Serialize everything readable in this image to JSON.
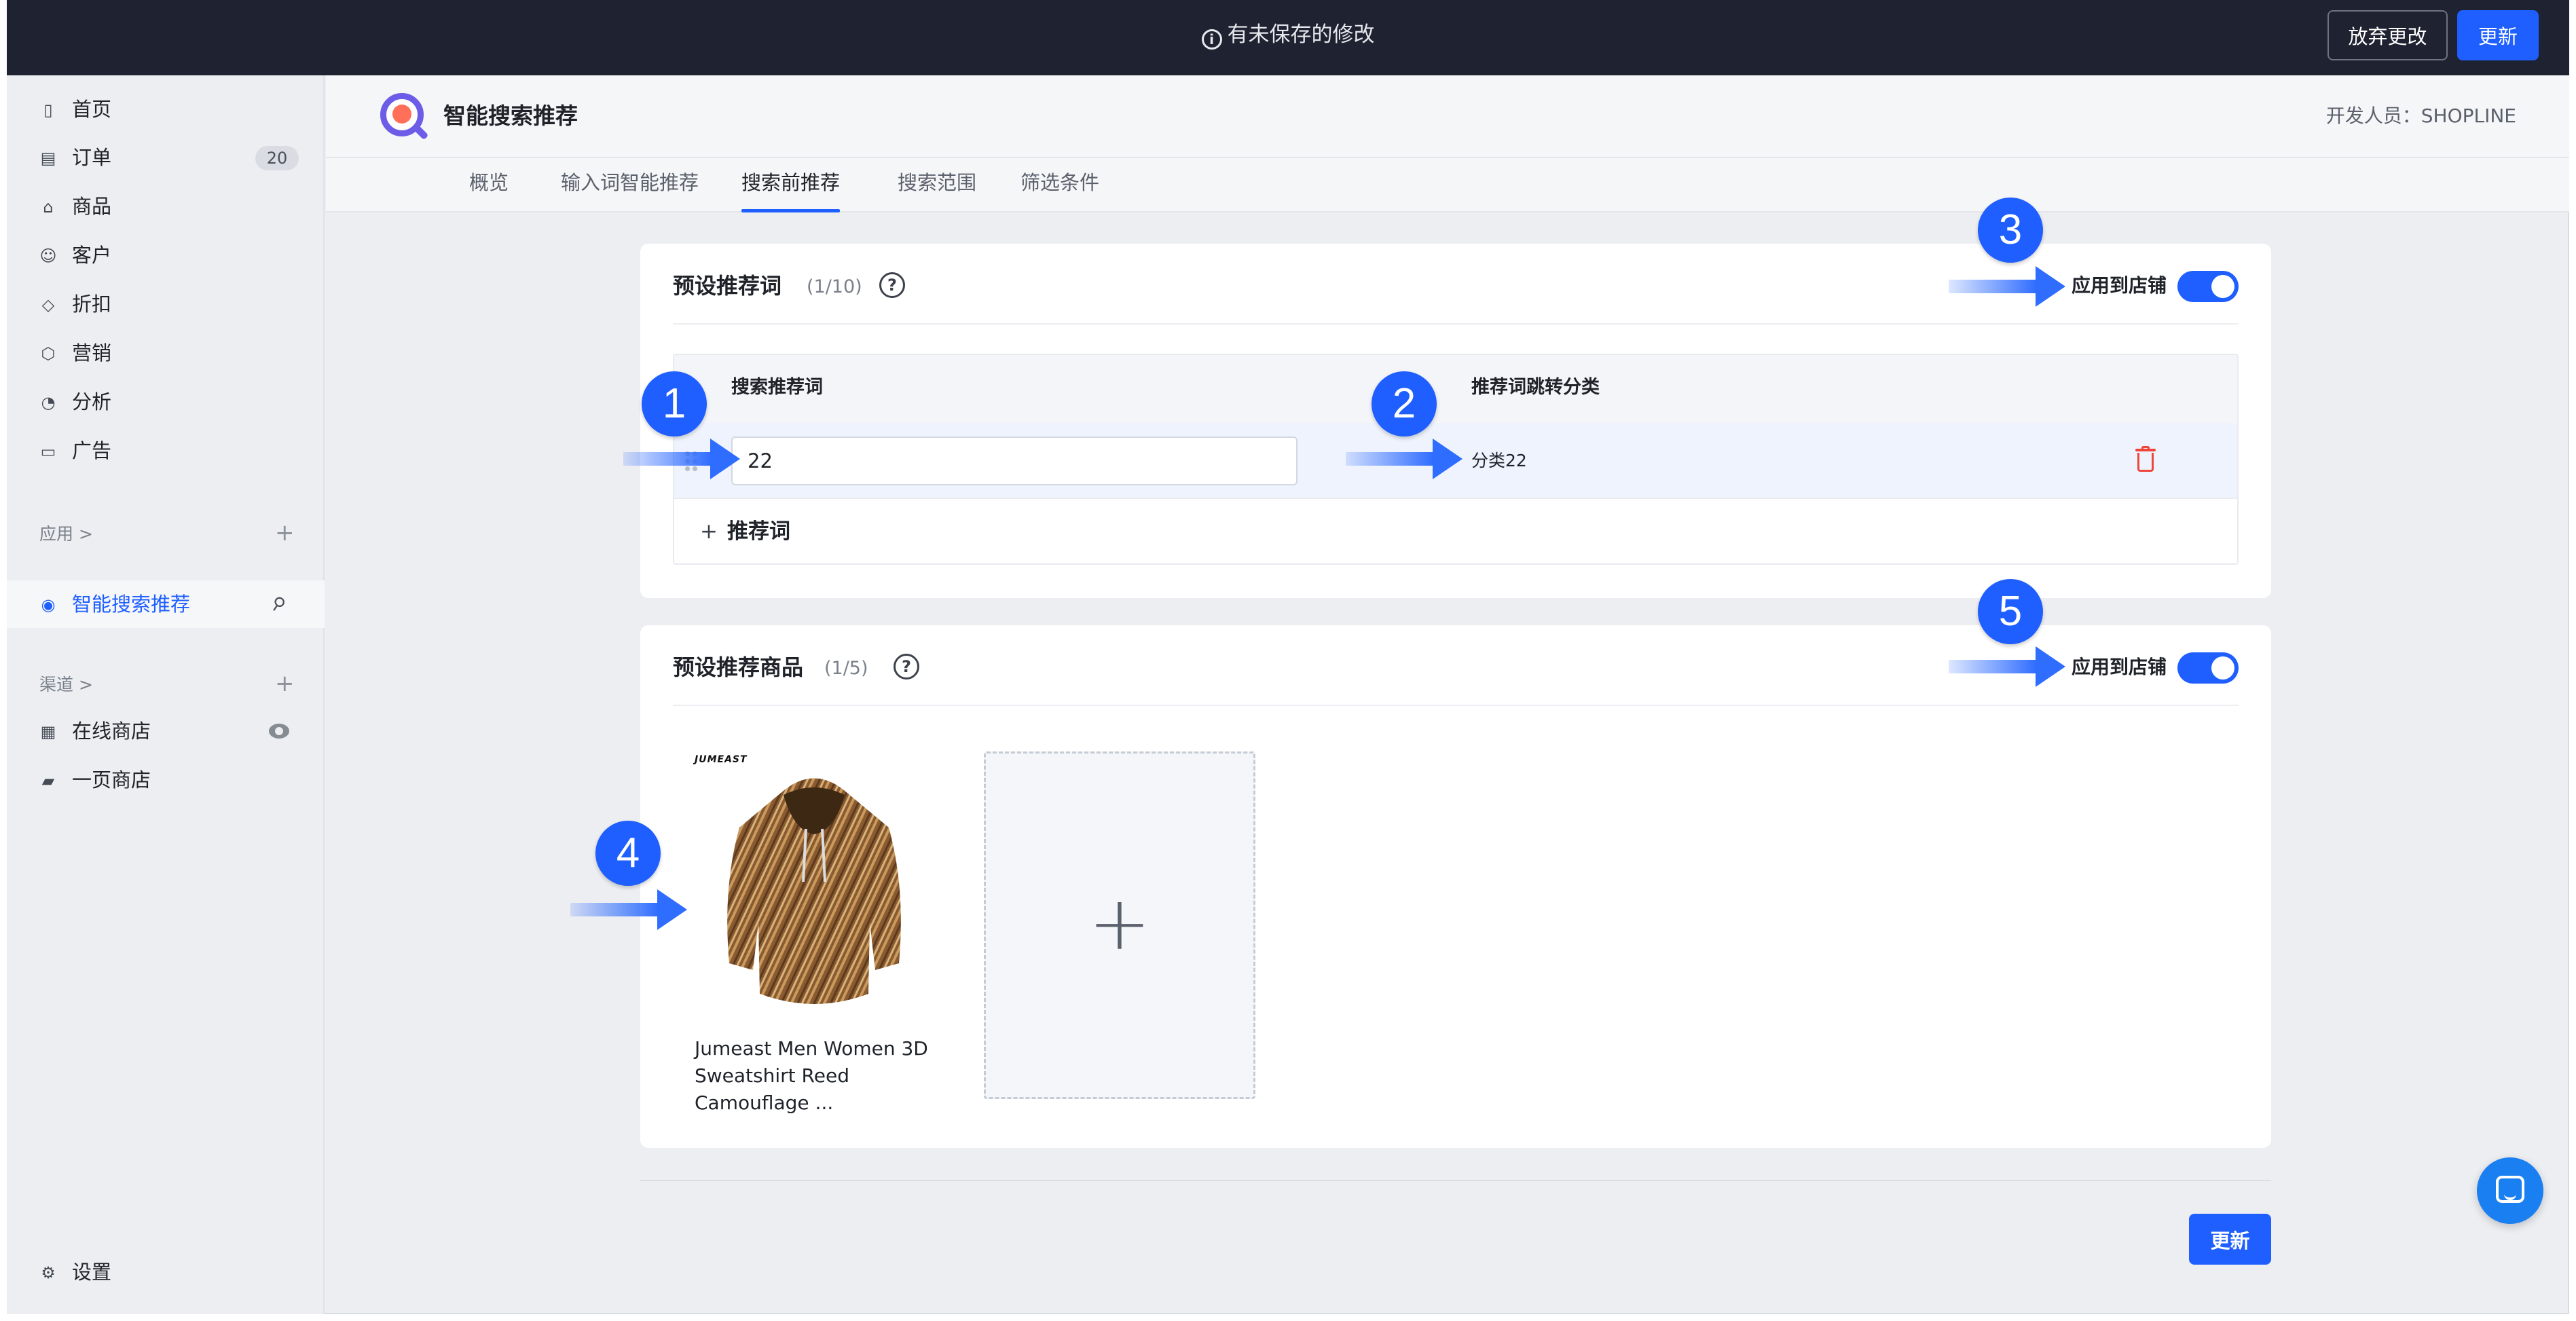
{
  "topbar": {
    "message": "有未保存的修改",
    "discard_label": "放弃更改",
    "update_label": "更新"
  },
  "sidebar": {
    "items": [
      {
        "label": "首页",
        "icon": "home-icon"
      },
      {
        "label": "订单",
        "icon": "order-icon",
        "badge": "20"
      },
      {
        "label": "商品",
        "icon": "bag-icon"
      },
      {
        "label": "客户",
        "icon": "user-icon"
      },
      {
        "label": "折扣",
        "icon": "tag-icon"
      },
      {
        "label": "营销",
        "icon": "box-icon"
      },
      {
        "label": "分析",
        "icon": "pie-chart-icon"
      },
      {
        "label": "广告",
        "icon": "ad-icon"
      }
    ],
    "apps_section": "应用 >",
    "active_app": "智能搜索推荐",
    "channels_section": "渠道 >",
    "channels": [
      {
        "label": "在线商店",
        "icon": "store-icon"
      },
      {
        "label": "一页商店",
        "icon": "brush-icon"
      }
    ],
    "settings_label": "设置"
  },
  "header": {
    "app_title": "智能搜索推荐",
    "developer": "开发人员：SHOPLINE"
  },
  "tabs": [
    {
      "label": "概览"
    },
    {
      "label": "输入词智能推荐"
    },
    {
      "label": "搜索前推荐",
      "active": true
    },
    {
      "label": "搜索范围"
    },
    {
      "label": "筛选条件"
    }
  ],
  "keywords_card": {
    "title": "预设推荐词",
    "count": "(1/10)",
    "apply_label": "应用到店铺",
    "apply_enabled": true,
    "col_keyword": "搜索推荐词",
    "col_category": "推荐词跳转分类",
    "row": {
      "keyword": "22",
      "category": "分类22"
    },
    "add_label": "推荐词"
  },
  "products_card": {
    "title": "预设推荐商品",
    "count": "(1/5)",
    "apply_label": "应用到店铺",
    "apply_enabled": true,
    "product": {
      "brand": "JUMEAST",
      "title": "Jumeast Men Women 3D Sweatshirt Reed Camouflage ..."
    }
  },
  "footer": {
    "update_label": "更新"
  },
  "annotations": [
    "1",
    "2",
    "3",
    "4",
    "5"
  ],
  "colors": {
    "accent": "#1f5fff",
    "topbar": "#1f2230",
    "danger": "#f0453a",
    "background": "#eceef2"
  }
}
